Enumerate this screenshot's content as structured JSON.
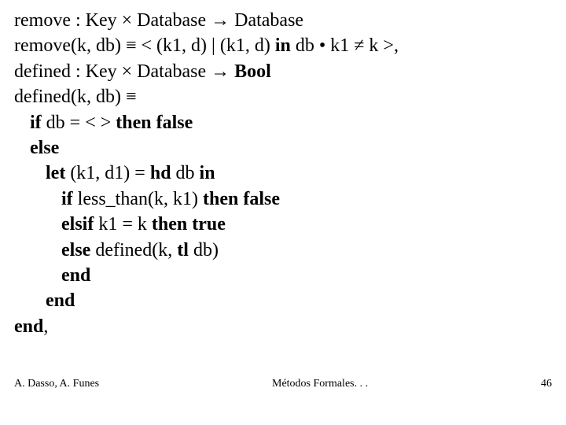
{
  "lines": {
    "l1a": "remove : Key ",
    "l1b": " Database ",
    "l1c": " Database",
    "l2a": "remove(k, db) ",
    "l2b": " < (k1, d) | (k1, d) ",
    "l2c": "in",
    "l2d": " db • k1 ",
    "l2e": " k >,",
    "l3a": "defined : Key ",
    "l3b": " Database ",
    "l3c": " ",
    "l3d": "Bool",
    "l4a": "defined(k, db) ",
    "l4b": "",
    "l5a": "if",
    "l5b": " db = < > ",
    "l5c": "then false",
    "l6": "else",
    "l7a": "let",
    "l7b": " (k1, d1) = ",
    "l7c": "hd",
    "l7d": " db ",
    "l7e": "in",
    "l8a": "if",
    "l8b": " less_than(k, k1) ",
    "l8c": "then false",
    "l9a": "elsif",
    "l9b": " k1 = k ",
    "l9c": "then true",
    "l10a": "else",
    "l10b": " defined(k, ",
    "l10c": "tl",
    "l10d": " db)",
    "l11": "end",
    "l12": "end",
    "l13": "end",
    "l13b": ","
  },
  "sym": {
    "times": "×",
    "arrow": "→",
    "equiv": "≡",
    "neq": "≠"
  },
  "footer": {
    "left": "A. Dasso, A. Funes",
    "center": "Métodos Formales. . .",
    "right": "46"
  }
}
